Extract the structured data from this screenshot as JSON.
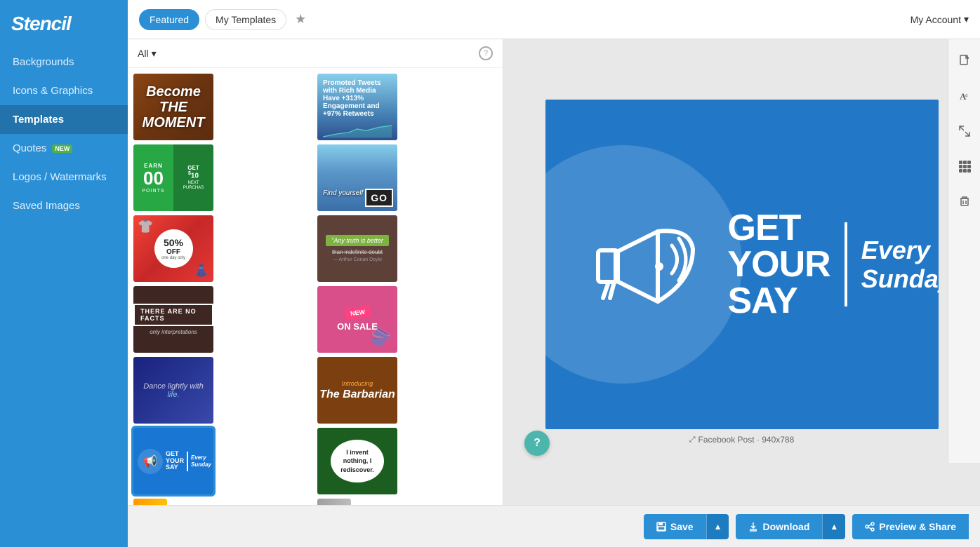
{
  "app": {
    "title": "Stencil"
  },
  "topbar": {
    "featured_label": "Featured",
    "my_templates_label": "My Templates",
    "account_label": "My Account"
  },
  "sidebar": {
    "items": [
      {
        "id": "backgrounds",
        "label": "Backgrounds"
      },
      {
        "id": "icons-graphics",
        "label": "Icons & Graphics"
      },
      {
        "id": "templates",
        "label": "Templates",
        "active": true
      },
      {
        "id": "quotes",
        "label": "Quotes",
        "badge": "NEW"
      },
      {
        "id": "logos-watermarks",
        "label": "Logos / Watermarks"
      },
      {
        "id": "saved-images",
        "label": "Saved Images"
      }
    ]
  },
  "filter": {
    "label": "All",
    "help_label": "?"
  },
  "canvas": {
    "title_line1": "GET",
    "title_line2": "YOUR",
    "title_line3": "SAY",
    "subtitle_line1": "Every",
    "subtitle_line2": "Sunday",
    "size_label": "Facebook Post · 940x788"
  },
  "actions": {
    "save_label": "Save",
    "download_label": "Download",
    "preview_label": "Preview & Share"
  }
}
